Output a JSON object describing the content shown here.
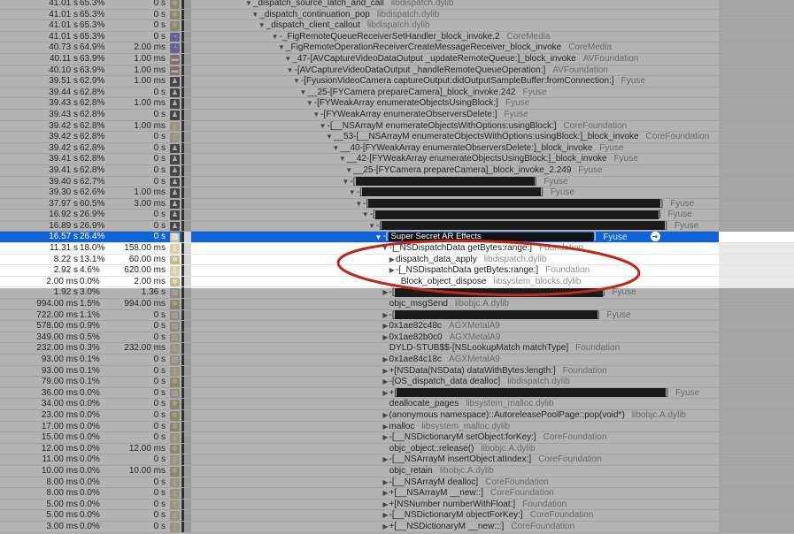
{
  "call_tree": {
    "selected_index": 21,
    "rows": [
      {
        "total": "41.01 s",
        "pct": "65.3%",
        "self": "0 s",
        "icon": "gear",
        "depth": 0,
        "tri": "down",
        "symbol": "_dispatch_source_latch_and_call",
        "lib": "libdispatch.dylib"
      },
      {
        "total": "41.01 s",
        "pct": "65.3%",
        "self": "0 s",
        "icon": "gear",
        "depth": 1,
        "tri": "down",
        "symbol": "_dispatch_continuation_pop",
        "lib": "libdispatch.dylib"
      },
      {
        "total": "41.01 s",
        "pct": "65.3%",
        "self": "0 s",
        "icon": "gear",
        "depth": 2,
        "tri": "down",
        "symbol": "_dispatch_client_callout",
        "lib": "libdispatch.dylib"
      },
      {
        "total": "41.01 s",
        "pct": "65.3%",
        "self": "0 s",
        "icon": "pie",
        "depth": 4,
        "tri": "down",
        "symbol": "-_FigRemoteQueueReceiverSetHandler_block_invoke.2",
        "lib": "CoreMedia"
      },
      {
        "total": "40.73 s",
        "pct": "64.9%",
        "self": "2.00 ms",
        "icon": "pie",
        "depth": 5,
        "tri": "down",
        "symbol": "_FigRemoteOperationReceiverCreateMessageReceiver_block_invoke",
        "lib": "CoreMedia"
      },
      {
        "total": "40.11 s",
        "pct": "63.9%",
        "self": "1.00 ms",
        "icon": "briefcase",
        "depth": 6,
        "tri": "down",
        "symbol": "_47-[AVCaptureVideoDataOutput _updateRemoteQueue:]_block_invoke",
        "lib": "AVFoundation"
      },
      {
        "total": "40.10 s",
        "pct": "63.9%",
        "self": "1.00 ms",
        "icon": "briefcase",
        "depth": 6.3,
        "tri": "down",
        "symbol": "-[AVCaptureVideoDataOutput _handleRemoteQueueOperation:]",
        "lib": "AVFoundation"
      },
      {
        "total": "39.51 s",
        "pct": "62.9%",
        "self": "1.00 ms",
        "icon": "person",
        "depth": 7.3,
        "tri": "down",
        "symbol": "-[FyusionVideoCamera captureOutput:didOutputSampleBuffer:fromConnection:]",
        "lib": "Fyuse"
      },
      {
        "total": "39.44 s",
        "pct": "62.8%",
        "self": "0 s",
        "icon": "person",
        "depth": 8.3,
        "tri": "down",
        "symbol": "__25-[FYCamera prepareCamera]_block_invoke.242",
        "lib": "Fyuse"
      },
      {
        "total": "39.43 s",
        "pct": "62.8%",
        "self": "1.00 ms",
        "icon": "person",
        "depth": 9.3,
        "tri": "down",
        "symbol": "-[FYWeakArray enumerateObjectsUsingBlock:]",
        "lib": "Fyuse"
      },
      {
        "total": "39.43 s",
        "pct": "62.8%",
        "self": "0 s",
        "icon": "person",
        "depth": 10.3,
        "tri": "down",
        "symbol": "-[FYWeakArray enumerateObserversDelete:]",
        "lib": "Fyuse"
      },
      {
        "total": "39.42 s",
        "pct": "62.8%",
        "self": "1.00 ms",
        "icon": "cup",
        "depth": 11.3,
        "tri": "down",
        "symbol": "-[__NSArrayM enumerateObjectsWithOptions:usingBlock:]",
        "lib": "CoreFoundation"
      },
      {
        "total": "39.42 s",
        "pct": "62.8%",
        "self": "0 s",
        "icon": "cup",
        "depth": 12.3,
        "tri": "down",
        "symbol": "__53-[__NSArrayM enumerateObjectsWithOptions:usingBlock:]_block_invoke",
        "lib": "CoreFoundation"
      },
      {
        "total": "39.42 s",
        "pct": "62.8%",
        "self": "0 s",
        "icon": "person",
        "depth": 13.3,
        "tri": "down",
        "symbol": "__40-[FYWeakArray enumerateObserversDelete:]_block_invoke",
        "lib": "Fyuse"
      },
      {
        "total": "39.41 s",
        "pct": "62.8%",
        "self": "0 s",
        "icon": "person",
        "depth": 14.3,
        "tri": "down",
        "symbol": "__42-[FYWeakArray enumerateObjectsUsingBlock:]_block_invoke",
        "lib": "Fyuse"
      },
      {
        "total": "39.41 s",
        "pct": "62.8%",
        "self": "0 s",
        "icon": "person",
        "depth": 15.3,
        "tri": "down",
        "symbol": "__25-[FYCamera prepareCamera]_block_invoke_2.249",
        "lib": "Fyuse"
      },
      {
        "total": "39.40 s",
        "pct": "62.7%",
        "self": "0 s",
        "icon": "person",
        "depth": 14.8,
        "tri": "down",
        "symbol": "-[",
        "redacted": 202,
        "lib": "Fyuse"
      },
      {
        "total": "39.30 s",
        "pct": "62.6%",
        "self": "1.00 ms",
        "icon": "person",
        "depth": 15.8,
        "tri": "down",
        "symbol": "-[",
        "redacted": 202,
        "lib": "Fyuse"
      },
      {
        "total": "37.97 s",
        "pct": "60.5%",
        "self": "3.00 ms",
        "icon": "person",
        "depth": 16.8,
        "tri": "down",
        "symbol": "-[",
        "redacted": 330,
        "lib": "Fyuse"
      },
      {
        "total": "16.92 s",
        "pct": "26.9%",
        "self": "0 s",
        "icon": "person",
        "depth": 17.8,
        "tri": "down",
        "symbol": "-[",
        "redacted": 320,
        "lib": "Fyuse"
      },
      {
        "total": "16.89 s",
        "pct": "26.9%",
        "self": "0 s",
        "icon": "person",
        "depth": 18.8,
        "tri": "down",
        "symbol": "-[",
        "redacted": 320,
        "lib": "Fyuse"
      },
      {
        "total": "16.57 s",
        "pct": "26.4%",
        "self": "0 s",
        "icon": "building",
        "depth": 19.8,
        "tri": "down",
        "symbol": "-[",
        "redacted": 232,
        "redacted_label": "Super Secret AR Effects",
        "lib": "Fyuse",
        "go": true
      },
      {
        "total": "11.31 s",
        "pct": "18.0%",
        "self": "158.00 ms",
        "icon": "cup",
        "depth": 20.8,
        "tri": "down",
        "symbol": "-[_NSDispatchData getBytes:range:]",
        "lib": "Foundation"
      },
      {
        "total": "8.22 s",
        "pct": "13.1%",
        "self": "60.00 ms",
        "icon": "gear",
        "depth": 22,
        "tri": "right",
        "symbol": "dispatch_data_apply",
        "lib": "libdispatch.dylib"
      },
      {
        "total": "2.92 s",
        "pct": "4.6%",
        "self": "620.00 ms",
        "icon": "cup",
        "depth": 22,
        "tri": "right",
        "symbol": "-[_NSDispatchData getBytes:range:]",
        "lib": "Foundation"
      },
      {
        "total": "2.00 ms",
        "pct": "0.0%",
        "self": "2.00 ms",
        "icon": "gear",
        "depth": 23,
        "tri": "",
        "symbol": "_Block_object_dispose",
        "lib": "libsystem_blocks.dylib"
      },
      {
        "total": "1.92 s",
        "pct": "3.0%",
        "self": "1.36 s",
        "icon": "building",
        "depth": 21,
        "tri": "right",
        "symbol": "-[",
        "redacted": 235,
        "lib": "Fyuse"
      },
      {
        "total": "994.00 ms",
        "pct": "1.5%",
        "self": "994.00 ms",
        "icon": "gear",
        "depth": 22,
        "tri": "",
        "symbol": "objc_msgSend",
        "lib": "libobjc.A.dylib"
      },
      {
        "total": "722.00 ms",
        "pct": "1.1%",
        "self": "0 s",
        "icon": "building",
        "depth": 21,
        "tri": "right",
        "symbol": "-[",
        "redacted": 229,
        "lib": "Fyuse"
      },
      {
        "total": "578.00 ms",
        "pct": "0.9%",
        "self": "0 s",
        "icon": "building",
        "depth": 21,
        "tri": "right",
        "symbol": "0x1ae82c48c",
        "lib": "AGXMetalA9"
      },
      {
        "total": "349.00 ms",
        "pct": "0.5%",
        "self": "0 s",
        "icon": "building",
        "depth": 21,
        "tri": "right",
        "symbol": "0x1ae82b0c0",
        "lib": "AGXMetalA9"
      },
      {
        "total": "232.00 ms",
        "pct": "0.3%",
        "self": "232.00 ms",
        "icon": "cup",
        "depth": 22,
        "tri": "",
        "symbol": "DYLD-STUB$$-[NSLookupMatch matchType]",
        "lib": "Foundation"
      },
      {
        "total": "93.00 ms",
        "pct": "0.1%",
        "self": "0 s",
        "icon": "building",
        "depth": 21,
        "tri": "right",
        "symbol": "0x1ae84c18c",
        "lib": "AGXMetalA9"
      },
      {
        "total": "93.00 ms",
        "pct": "0.1%",
        "self": "0 s",
        "icon": "cup",
        "depth": 21,
        "tri": "right",
        "symbol": "+[NSData(NSData) dataWithBytes:length:]",
        "lib": "Foundation"
      },
      {
        "total": "79.00 ms",
        "pct": "0.1%",
        "self": "0 s",
        "icon": "gear",
        "depth": 21,
        "tri": "right",
        "symbol": "-[OS_dispatch_data dealloc]",
        "lib": "libdispatch.dylib"
      },
      {
        "total": "36.00 ms",
        "pct": "0.0%",
        "self": "0 s",
        "icon": "building",
        "depth": 21,
        "tri": "right",
        "symbol": "+[",
        "redacted": 304,
        "lib": "Fyuse"
      },
      {
        "total": "34.00 ms",
        "pct": "0.0%",
        "self": "0 s",
        "icon": "gear",
        "depth": 22,
        "tri": "",
        "symbol": "deallocate_pages",
        "lib": "libsystem_malloc.dylib"
      },
      {
        "total": "23.00 ms",
        "pct": "0.0%",
        "self": "0 s",
        "icon": "gear",
        "depth": 21,
        "tri": "right",
        "symbol": "(anonymous namespace)::AutoreleasePoolPage::pop(void*)",
        "lib": "libobjc.A.dylib"
      },
      {
        "total": "17.00 ms",
        "pct": "0.0%",
        "self": "0 s",
        "icon": "gear",
        "depth": 21,
        "tri": "right",
        "symbol": "malloc",
        "lib": "libsystem_malloc.dylib"
      },
      {
        "total": "15.00 ms",
        "pct": "0.0%",
        "self": "0 s",
        "icon": "cup",
        "depth": 21,
        "tri": "right",
        "symbol": "-[__NSDictionaryM setObject:forKey:]",
        "lib": "CoreFoundation"
      },
      {
        "total": "12.00 ms",
        "pct": "0.0%",
        "self": "12.00 ms",
        "icon": "gear",
        "depth": 22,
        "tri": "",
        "symbol": "objc_object::release()",
        "lib": "libobjc.A.dylib"
      },
      {
        "total": "11.00 ms",
        "pct": "0.0%",
        "self": "0 s",
        "icon": "cup",
        "depth": 21,
        "tri": "right",
        "symbol": "-[__NSArrayM insertObject:atIndex:]",
        "lib": "CoreFoundation"
      },
      {
        "total": "10.00 ms",
        "pct": "0.0%",
        "self": "10.00 ms",
        "icon": "gear",
        "depth": 22,
        "tri": "",
        "symbol": "objc_retain",
        "lib": "libobjc.A.dylib"
      },
      {
        "total": "8.00 ms",
        "pct": "0.0%",
        "self": "0 s",
        "icon": "cup",
        "depth": 21,
        "tri": "right",
        "symbol": "-[__NSArrayM dealloc]",
        "lib": "CoreFoundation"
      },
      {
        "total": "8.00 ms",
        "pct": "0.0%",
        "self": "0 s",
        "icon": "cup",
        "depth": 21,
        "tri": "right",
        "symbol": "+[__NSArrayM __new::]",
        "lib": "CoreFoundation"
      },
      {
        "total": "5.00 ms",
        "pct": "0.0%",
        "self": "0 s",
        "icon": "cup",
        "depth": 21,
        "tri": "right",
        "symbol": "+[NSNumber numberWithFloat:]",
        "lib": "Foundation"
      },
      {
        "total": "5.00 ms",
        "pct": "0.0%",
        "self": "0 s",
        "icon": "cup",
        "depth": 21,
        "tri": "right",
        "symbol": "-[__NSDictionaryM objectForKey:]",
        "lib": "CoreFoundation"
      },
      {
        "total": "3.00 ms",
        "pct": "0.0%",
        "self": "0 s",
        "icon": "cup",
        "depth": 21,
        "tri": "right",
        "symbol": "+[__NSDictionaryM __new:::]",
        "lib": "CoreFoundation"
      }
    ]
  },
  "colors": {
    "selection": "#0f63d6",
    "annotation": "#c0281e"
  }
}
